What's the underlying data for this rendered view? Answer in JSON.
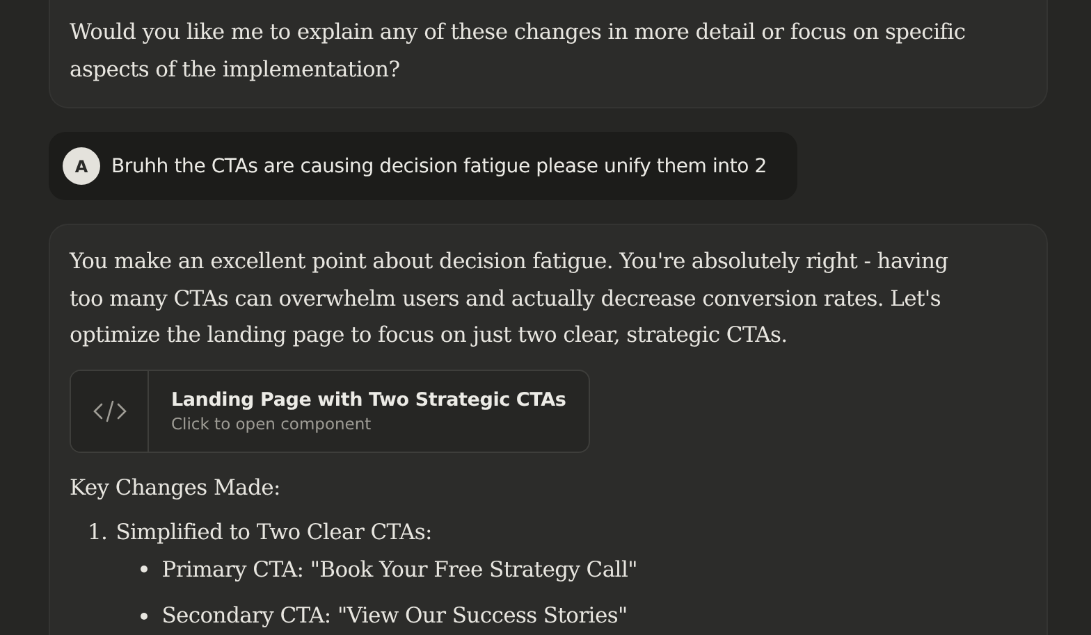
{
  "previous_reply": {
    "text": "Would you like me to explain any of these changes in more detail or focus on specific aspects of the implementation?"
  },
  "user_message": {
    "avatar": "A",
    "text": "Bruhh the CTAs are causing decision fatigue please unify them into 2"
  },
  "reply": {
    "intro": "You make an excellent point about decision fatigue. You're absolutely right - having too many CTAs can overwhelm users and actually decrease conversion rates. Let's optimize the landing page to focus on just two clear, strategic CTAs.",
    "artifact": {
      "title": "Landing Page with Two Strategic CTAs",
      "subtitle": "Click to open component"
    },
    "heading": "Key Changes Made:",
    "list": [
      {
        "number": "1.",
        "text": "Simplified to Two Clear CTAs:",
        "items": [
          "Primary CTA: \"Book Your Free Strategy Call\"",
          "Secondary CTA: \"View Our Success Stories\""
        ]
      }
    ]
  }
}
